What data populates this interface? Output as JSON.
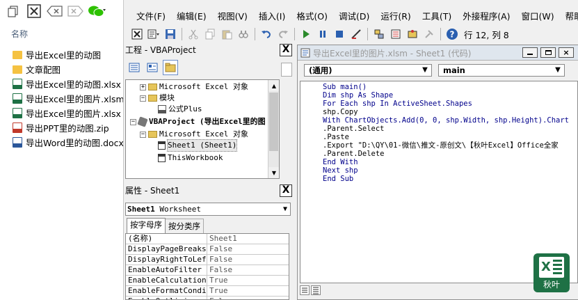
{
  "explorer": {
    "header": "名称",
    "files": [
      {
        "name": "导出Excel里的动图",
        "type": "folder",
        "color": "#f5c242"
      },
      {
        "name": "文章配图",
        "type": "folder",
        "color": "#f5c242"
      },
      {
        "name": "导出Excel里的动图.xlsx",
        "type": "xlsx",
        "color": "#1e7145"
      },
      {
        "name": "导出Excel里的图片.xlsm",
        "type": "xlsm",
        "color": "#1e7145"
      },
      {
        "name": "导出Excel里的图片.xlsx",
        "type": "xlsx",
        "color": "#1e7145"
      },
      {
        "name": "导出PPT里的动图.zip",
        "type": "zip",
        "color": "#c0392b"
      },
      {
        "name": "导出Word里的动图.docx",
        "type": "docx",
        "color": "#2b579a"
      }
    ]
  },
  "menu": [
    "文件(F)",
    "编辑(E)",
    "视图(V)",
    "插入(I)",
    "格式(O)",
    "调试(D)",
    "运行(R)",
    "工具(T)",
    "外接程序(A)",
    "窗口(W)",
    "帮助(H)"
  ],
  "toolbar": {
    "position": "行 12, 列 8"
  },
  "project": {
    "title": "工程 - VBAProject",
    "close": "X",
    "tree": [
      {
        "label": "Microsoft Excel 对象",
        "indent": 1,
        "expander": "+"
      },
      {
        "label": "模块",
        "indent": 1,
        "expander": "-"
      },
      {
        "label": "公式Plus",
        "indent": 2,
        "expander": ""
      },
      {
        "label": "VBAProject (导出Excel里的图",
        "indent": 0,
        "expander": "-"
      },
      {
        "label": "Microsoft Excel 对象",
        "indent": 1,
        "expander": "-"
      },
      {
        "label": "Sheet1 (Sheet1)",
        "indent": 2,
        "expander": ""
      },
      {
        "label": "ThisWorkbook",
        "indent": 2,
        "expander": ""
      }
    ]
  },
  "properties": {
    "title": "属性 - Sheet1",
    "close": "X",
    "object": "Sheet1",
    "object_type": "Worksheet",
    "tabs": [
      "按字母序",
      "按分类序"
    ],
    "rows": [
      {
        "name": "(名称)",
        "value": "Sheet1"
      },
      {
        "name": "DisplayPageBreaks",
        "value": "False"
      },
      {
        "name": "DisplayRightToLeft",
        "value": "False"
      },
      {
        "name": "EnableAutoFilter",
        "value": "False"
      },
      {
        "name": "EnableCalculation",
        "value": "True"
      },
      {
        "name": "EnableFormatConditi",
        "value": "True"
      },
      {
        "name": "EnableOutlining",
        "value": "False"
      }
    ]
  },
  "code_window": {
    "title": "导出Excel里的图片.xlsm - Sheet1 (代码)",
    "object_combo": "(通用)",
    "proc_combo": "main",
    "lines": [
      "Sub main()",
      "Dim shp As Shape",
      "For Each shp In ActiveSheet.Shapes",
      "shp.Copy",
      "With ChartObjects.Add(0, 0, shp.Width, shp.Height).Chart",
      ".Parent.Select",
      ".Paste",
      ".Export \"D:\\QY\\01-微信\\推文-原创文\\【秋叶Excel】Office全家",
      ".Parent.Delete",
      "End With",
      "Next shp",
      "End Sub"
    ]
  },
  "watermark": {
    "label": "秋叶",
    "color": "#1e7145"
  }
}
